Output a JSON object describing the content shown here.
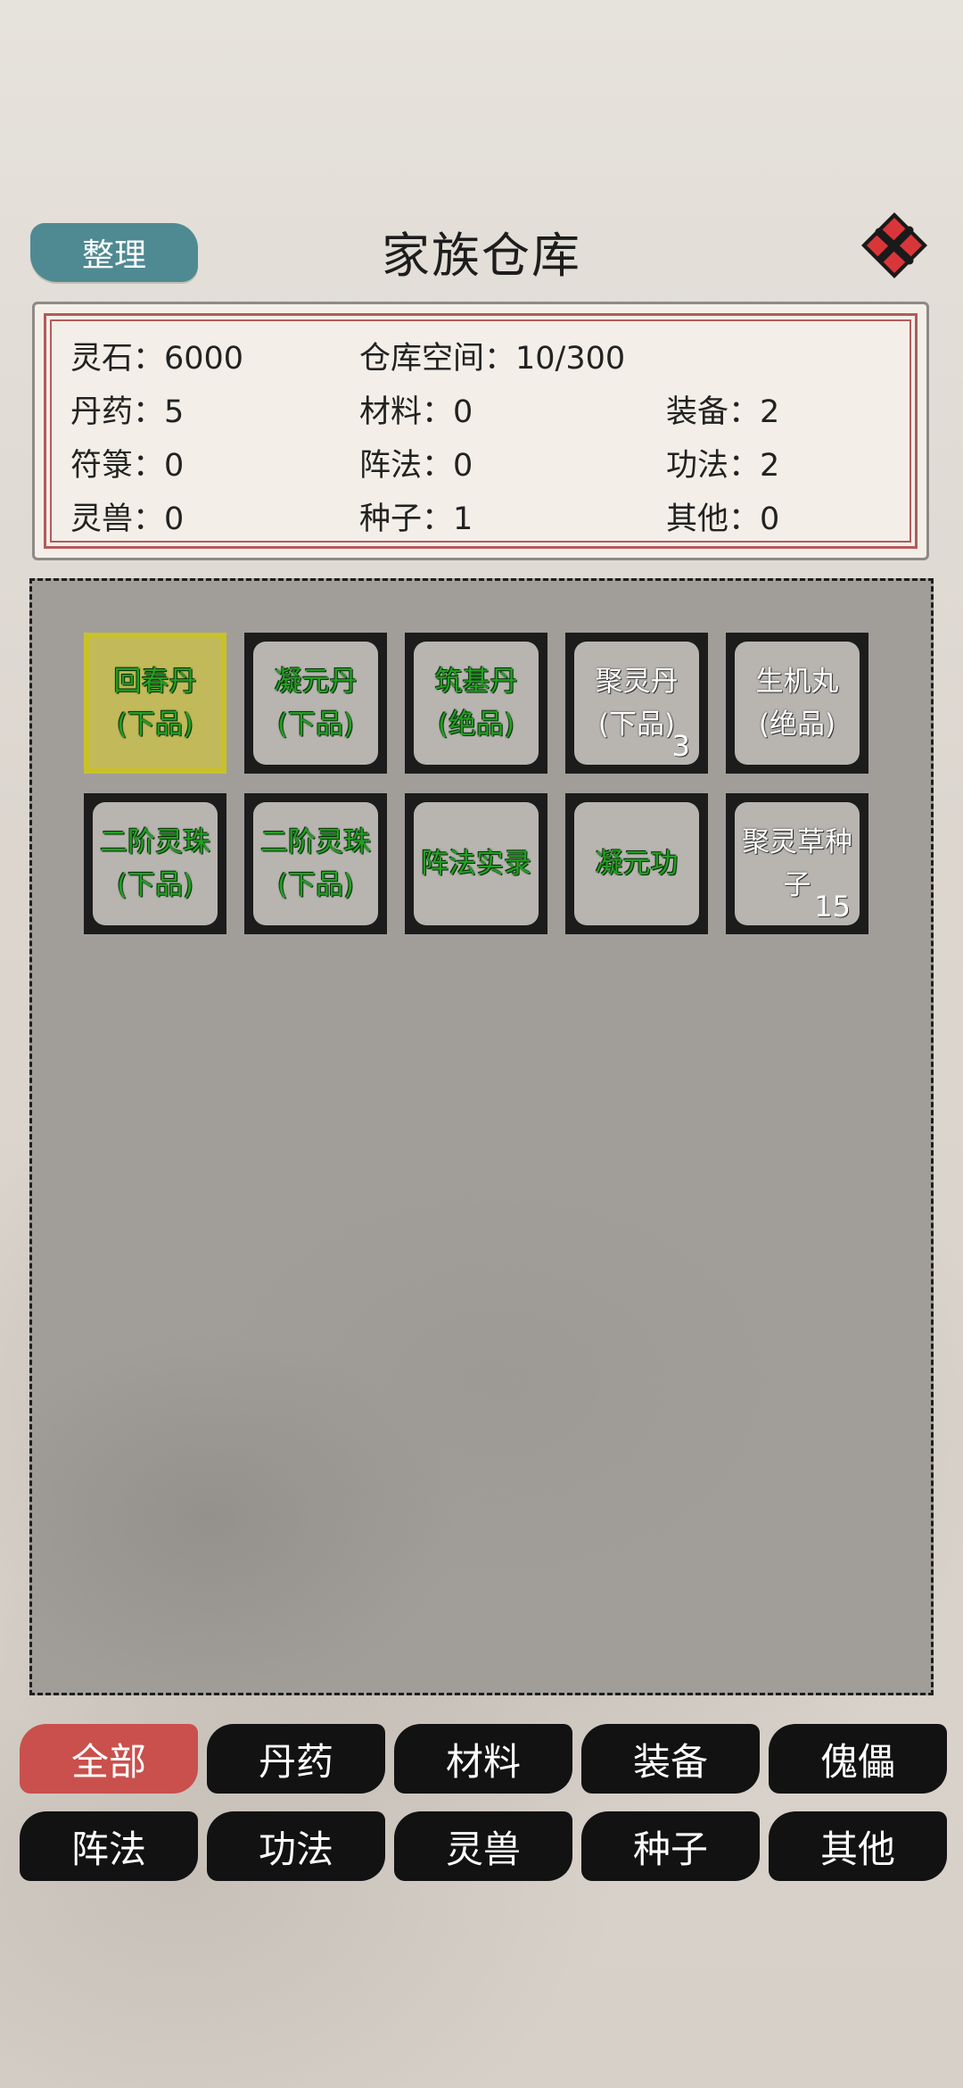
{
  "header": {
    "organize_label": "整理",
    "title": "家族仓库",
    "close_icon": "close-icon"
  },
  "stats": {
    "spirit_stone": "灵石：6000",
    "storage_space": "仓库空间：10/300",
    "pills": "丹药：5",
    "materials": "材料：0",
    "equipment": "装备：2",
    "talismans": "符箓：0",
    "formations": "阵法：0",
    "techniques": "功法：2",
    "beasts": "灵兽：0",
    "seeds": "种子：1",
    "others": "其他：0"
  },
  "items": [
    {
      "line1": "回春丹",
      "line2": "(下品)",
      "count": "",
      "color": "green",
      "selected": true
    },
    {
      "line1": "凝元丹",
      "line2": "(下品)",
      "count": "",
      "color": "green",
      "selected": false
    },
    {
      "line1": "筑基丹",
      "line2": "(绝品)",
      "count": "",
      "color": "green",
      "selected": false
    },
    {
      "line1": "聚灵丹",
      "line2": "(下品)",
      "count": "3",
      "color": "white",
      "selected": false
    },
    {
      "line1": "生机丸",
      "line2": "(绝品)",
      "count": "",
      "color": "white",
      "selected": false
    },
    {
      "line1": "二阶灵珠",
      "line2": "(下品)",
      "count": "",
      "color": "green",
      "selected": false
    },
    {
      "line1": "二阶灵珠",
      "line2": "(下品)",
      "count": "",
      "color": "green",
      "selected": false
    },
    {
      "line1": "阵法实录",
      "line2": "",
      "count": "",
      "color": "green",
      "selected": false
    },
    {
      "line1": "凝元功",
      "line2": "",
      "count": "",
      "color": "green",
      "selected": false
    },
    {
      "line1": "聚灵草种",
      "line2": "子",
      "count": "15",
      "color": "white",
      "selected": false
    }
  ],
  "categories": [
    {
      "label": "全部",
      "active": true
    },
    {
      "label": "丹药",
      "active": false
    },
    {
      "label": "材料",
      "active": false
    },
    {
      "label": "装备",
      "active": false
    },
    {
      "label": "傀儡",
      "active": false
    },
    {
      "label": "阵法",
      "active": false
    },
    {
      "label": "功法",
      "active": false
    },
    {
      "label": "灵兽",
      "active": false
    },
    {
      "label": "种子",
      "active": false
    },
    {
      "label": "其他",
      "active": false
    }
  ],
  "colors": {
    "accent_teal": "#4f8a92",
    "active_tab": "#c9504c",
    "close_red": "#d9363a",
    "green_text": "#22a122"
  }
}
